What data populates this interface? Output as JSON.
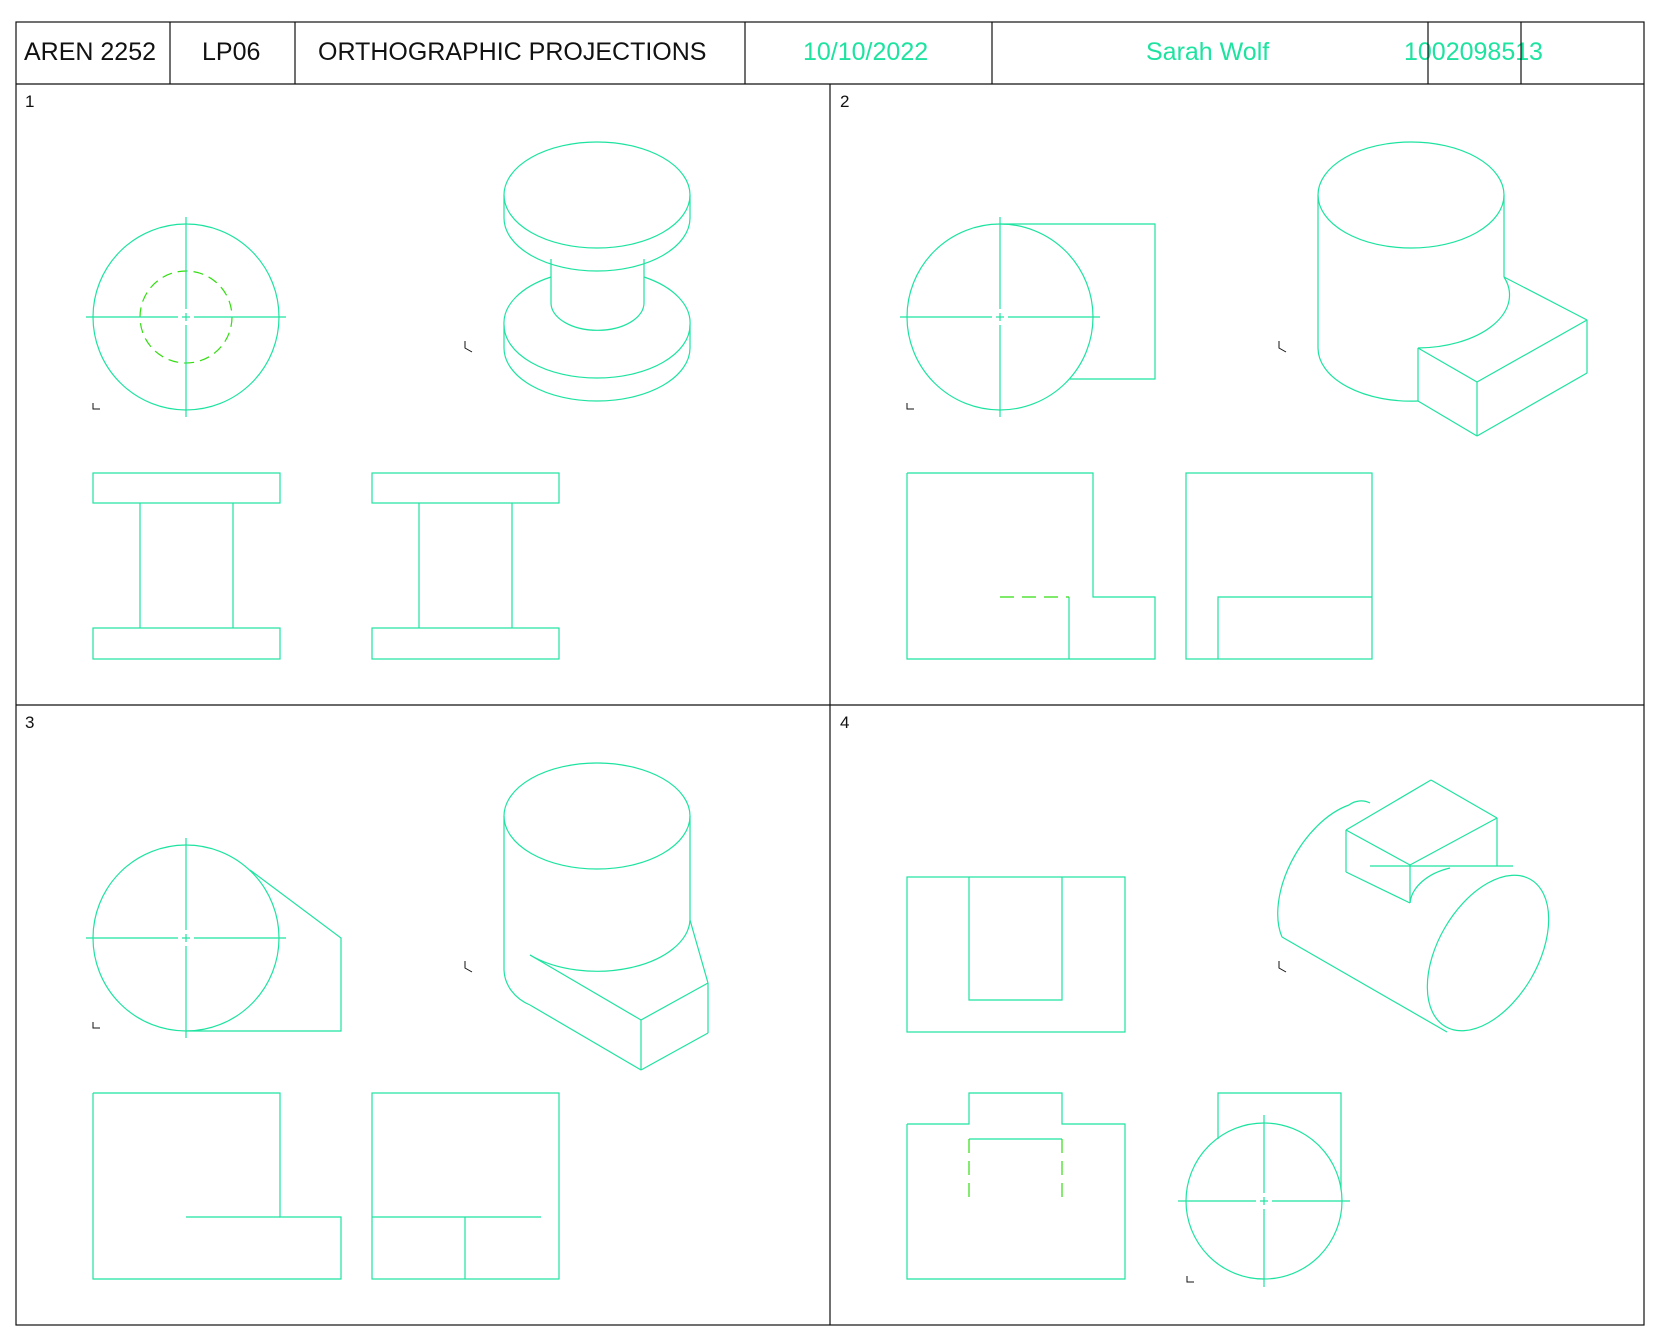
{
  "title_block": {
    "course": "AREN 2252",
    "assignment": "LP06",
    "title": "ORTHOGRAPHIC PROJECTIONS",
    "date": "10/10/2022",
    "name": "Sarah Wolf",
    "student_id": "100209851",
    "sheet_number": "3"
  },
  "panels": [
    {
      "number": "1"
    },
    {
      "number": "2"
    },
    {
      "number": "3"
    },
    {
      "number": "4"
    }
  ],
  "colors": {
    "line": "#1ee3a0",
    "hidden": "#33dd11",
    "border": "#111111",
    "text_dark": "#111111",
    "text_green": "#1ee3a0"
  }
}
